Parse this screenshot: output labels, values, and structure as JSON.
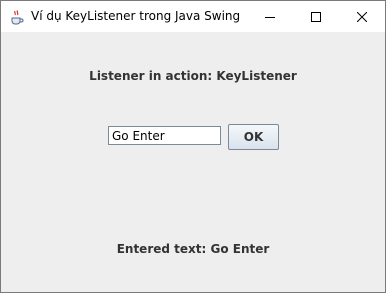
{
  "window": {
    "title": "Ví dụ KeyListener trong Java Swing",
    "app_icon": "java-cup-icon",
    "controls": [
      "minimize-icon",
      "maximize-icon",
      "close-icon"
    ]
  },
  "content": {
    "heading": "Listener in action: KeyListener",
    "text_field_value": "Go Enter",
    "ok_button_label": "OK",
    "status_text": "Entered text: Go Enter"
  },
  "colors": {
    "background": "#eeeeee",
    "titlebar": "#ffffff",
    "text": "#333333",
    "button_border": "#7a8a99"
  }
}
